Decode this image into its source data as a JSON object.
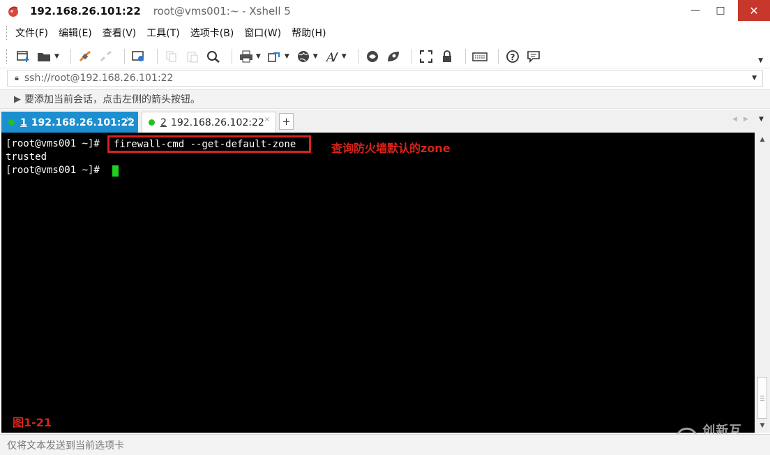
{
  "window": {
    "title_host": "192.168.26.101:22",
    "title_rest": "root@vms001:~ - Xshell 5",
    "minimize": "—",
    "maximize": "□",
    "close": "✕"
  },
  "menu": [
    {
      "label": "文件(F)"
    },
    {
      "label": "编辑(E)"
    },
    {
      "label": "查看(V)"
    },
    {
      "label": "工具(T)"
    },
    {
      "label": "选项卡(B)"
    },
    {
      "label": "窗口(W)"
    },
    {
      "label": "帮助(H)"
    }
  ],
  "toolbar": {
    "icons": [
      "new-session-icon",
      "open-folder-icon",
      "connect-icon",
      "disconnect-icon",
      "properties-icon",
      "copy-icon",
      "paste-icon",
      "find-icon",
      "print-icon",
      "transfer-icon",
      "globe-icon",
      "font-icon",
      "xftp-icon",
      "xmanager-icon",
      "fullscreen-icon",
      "lock-icon",
      "keyboard-icon",
      "help-icon",
      "chat-icon"
    ]
  },
  "address": {
    "value": "ssh://root@192.168.26.101:22"
  },
  "hint": {
    "text": "要添加当前会话，点击左侧的箭头按钮。"
  },
  "tabs": [
    {
      "number": "1",
      "label": "192.168.26.101:22",
      "active": true,
      "close": "×"
    },
    {
      "number": "2",
      "label": "192.168.26.102:22",
      "active": false,
      "close": "×"
    }
  ],
  "tab_add": "+",
  "terminal": {
    "prompt": "[root@vms001 ~]#",
    "command": "firewall-cmd --get-default-zone",
    "output": "trusted",
    "annotation": "查询防火墙默认的zone",
    "figure_label": "图1-21",
    "watermark": "创新互联"
  },
  "status": {
    "text": "仅将文本发送到当前选项卡"
  },
  "colors": {
    "accent_tab": "#1c8fd0",
    "annotation_red": "#d8231a",
    "cursor_green": "#1ed11e",
    "close_button": "#c7372b"
  }
}
